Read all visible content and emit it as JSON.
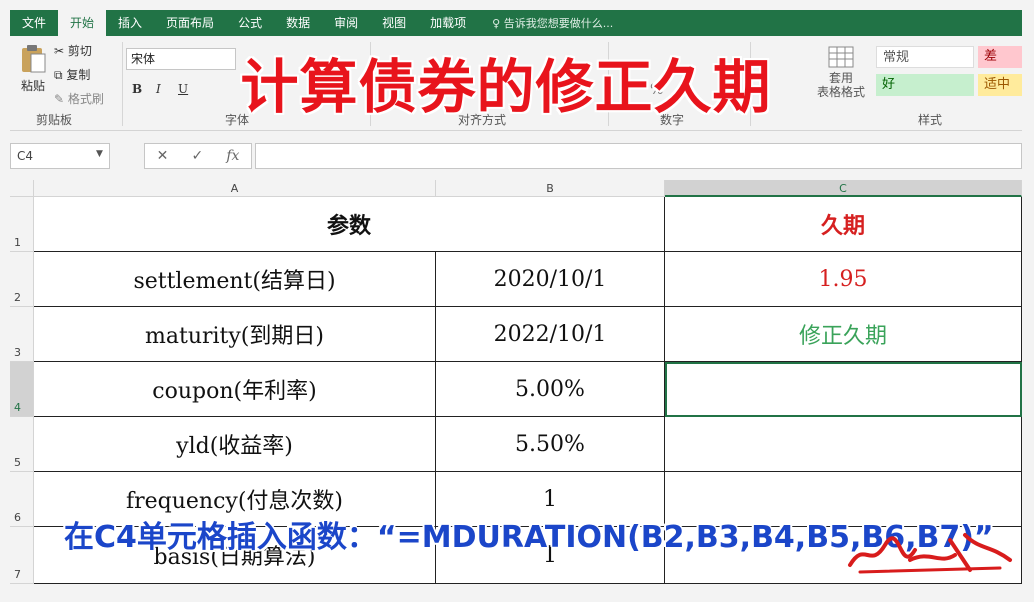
{
  "ribbon": {
    "tabs": [
      "文件",
      "开始",
      "插入",
      "页面布局",
      "公式",
      "数据",
      "审阅",
      "视图",
      "加载项"
    ],
    "active_tab": "开始",
    "tell_me": "告诉我您想要做什么...",
    "clipboard": {
      "paste": "粘贴",
      "cut": "剪切",
      "copy": "复制",
      "format_painter": "格式刷",
      "group": "剪贴板"
    },
    "font": {
      "name": "宋体",
      "bold": "B",
      "italic": "I",
      "underline": "U",
      "group": "字体"
    },
    "alignment": {
      "group": "对齐方式"
    },
    "number": {
      "percent": "%",
      "group": "数字"
    },
    "styles": {
      "table_format": "套用\n表格格式",
      "normal": "常规",
      "bad": "差",
      "good": "好",
      "neutral": "适中",
      "group": "样式"
    }
  },
  "formula_bar": {
    "name_box": "C4",
    "cancel": "✕",
    "enter": "✓",
    "fx": "fx",
    "content": ""
  },
  "columns": [
    "A",
    "B",
    "C"
  ],
  "rows": [
    {
      "num": "1",
      "a": "参数",
      "b": "",
      "c": "久期"
    },
    {
      "num": "2",
      "a": "settlement(结算日)",
      "b": "2020/10/1",
      "c": "1.95"
    },
    {
      "num": "3",
      "a": "maturity(到期日)",
      "b": "2022/10/1",
      "c": "修正久期"
    },
    {
      "num": "4",
      "a": "coupon(年利率)",
      "b": "5.00%",
      "c": ""
    },
    {
      "num": "5",
      "a": "yld(收益率)",
      "b": "5.50%",
      "c": ""
    },
    {
      "num": "6",
      "a": "frequency(付息次数)",
      "b": "1",
      "c": ""
    },
    {
      "num": "7",
      "a": "basis(日期算法)",
      "b": "1",
      "c": ""
    }
  ],
  "overlay": {
    "title": "计算债券的修正久期",
    "caption": "在C4单元格插入函数：“=MDURATION(B2,B3,B4,B5,B6,B7)”"
  },
  "colors": {
    "excel_green": "#217346",
    "title_red": "#e8141c",
    "caption_blue": "#1b46c9",
    "value_red": "#d62020",
    "label_green": "#3aa35a"
  }
}
